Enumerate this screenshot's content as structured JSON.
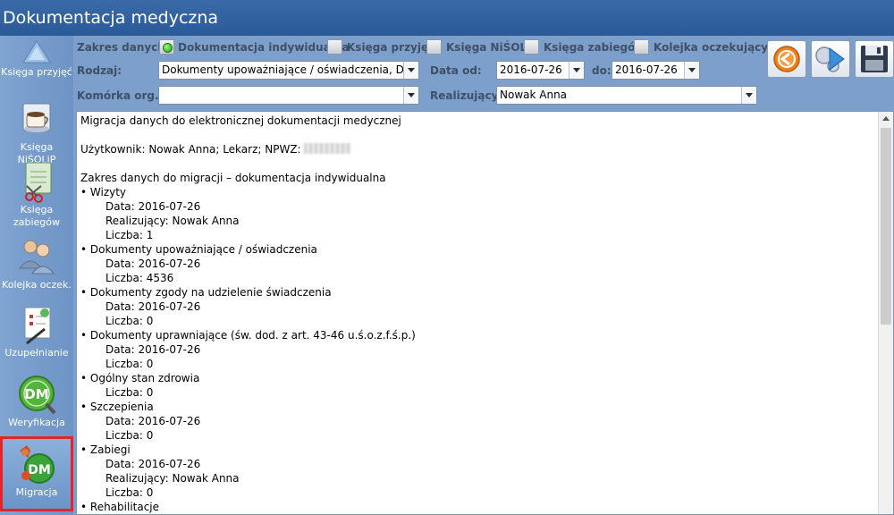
{
  "window": {
    "title": "Dokumentacja medyczna"
  },
  "sidebar": {
    "items": [
      {
        "label": "Księga przyjęć"
      },
      {
        "label": "Księga NiŚOLiP"
      },
      {
        "label": "Księga zabiegów"
      },
      {
        "label": "Kolejka oczek."
      },
      {
        "label": "Uzupełnianie"
      },
      {
        "label": "Weryfikacja"
      },
      {
        "label": "Migracja"
      }
    ],
    "active": "Migracja"
  },
  "filters": {
    "zakres_label": "Zakres danych:",
    "zakres_options": [
      {
        "label": "Dokumentacja indywidualna",
        "checked": true
      },
      {
        "label": "Księga przyjęć",
        "checked": false
      },
      {
        "label": "Księga NiŚOLiP",
        "checked": false
      },
      {
        "label": "Księga zabiegów",
        "checked": false
      },
      {
        "label": "Kolejka oczekujących",
        "checked": false
      }
    ],
    "rodzaj_label": "Rodzaj:",
    "rodzaj_value": "Dokumenty upoważniające / oświadczenia, Dok",
    "data_od_label": "Data od:",
    "data_od_value": "2016-07-26",
    "do_label": "do:",
    "do_value": "2016-07-26",
    "komorka_label": "Komórka org.:",
    "komorka_value": "",
    "realizujacy_label": "Realizujący:",
    "realizujacy_value": "Nowak Anna"
  },
  "report": {
    "lines": [
      {
        "text": "Migracja danych do elektronicznej dokumentacji medycznej",
        "indent": false
      },
      {
        "text": "",
        "indent": false
      },
      {
        "text": "Użytkownik: Nowak Anna; Lekarz; NPWZ: ",
        "indent": false,
        "redacted": true
      },
      {
        "text": "",
        "indent": false
      },
      {
        "text": "Zakres danych do migracji – dokumentacja indywidualna",
        "indent": false
      },
      {
        "text": "• Wizyty",
        "indent": false
      },
      {
        "text": "Data: 2016-07-26",
        "indent": true
      },
      {
        "text": "Realizujący: Nowak Anna",
        "indent": true
      },
      {
        "text": "Liczba: 1",
        "indent": true
      },
      {
        "text": "• Dokumenty upoważniające / oświadczenia",
        "indent": false
      },
      {
        "text": "Data: 2016-07-26",
        "indent": true
      },
      {
        "text": "Liczba: 4536",
        "indent": true
      },
      {
        "text": "• Dokumenty zgody na udzielenie świadczenia",
        "indent": false
      },
      {
        "text": "Data: 2016-07-26",
        "indent": true
      },
      {
        "text": "Liczba: 0",
        "indent": true
      },
      {
        "text": "• Dokumenty uprawniające (św. dod. z art. 43-46 u.ś.o.z.f.ś.p.)",
        "indent": false
      },
      {
        "text": "Data: 2016-07-26",
        "indent": true
      },
      {
        "text": "Liczba: 0",
        "indent": true
      },
      {
        "text": "• Ogólny stan zdrowia",
        "indent": false
      },
      {
        "text": "Liczba: 0",
        "indent": true
      },
      {
        "text": "• Szczepienia",
        "indent": false
      },
      {
        "text": "Data: 2016-07-26",
        "indent": true
      },
      {
        "text": "Liczba: 0",
        "indent": true
      },
      {
        "text": "• Zabiegi",
        "indent": false
      },
      {
        "text": "Data: 2016-07-26",
        "indent": true
      },
      {
        "text": "Realizujący: Nowak Anna",
        "indent": true
      },
      {
        "text": "Liczba: 0",
        "indent": true
      },
      {
        "text": "• Rehabilitacje",
        "indent": false
      }
    ]
  },
  "icons": {
    "toolbar": [
      "run-orange-icon",
      "migrate-arrow-icon",
      "save-floppy-icon"
    ]
  }
}
